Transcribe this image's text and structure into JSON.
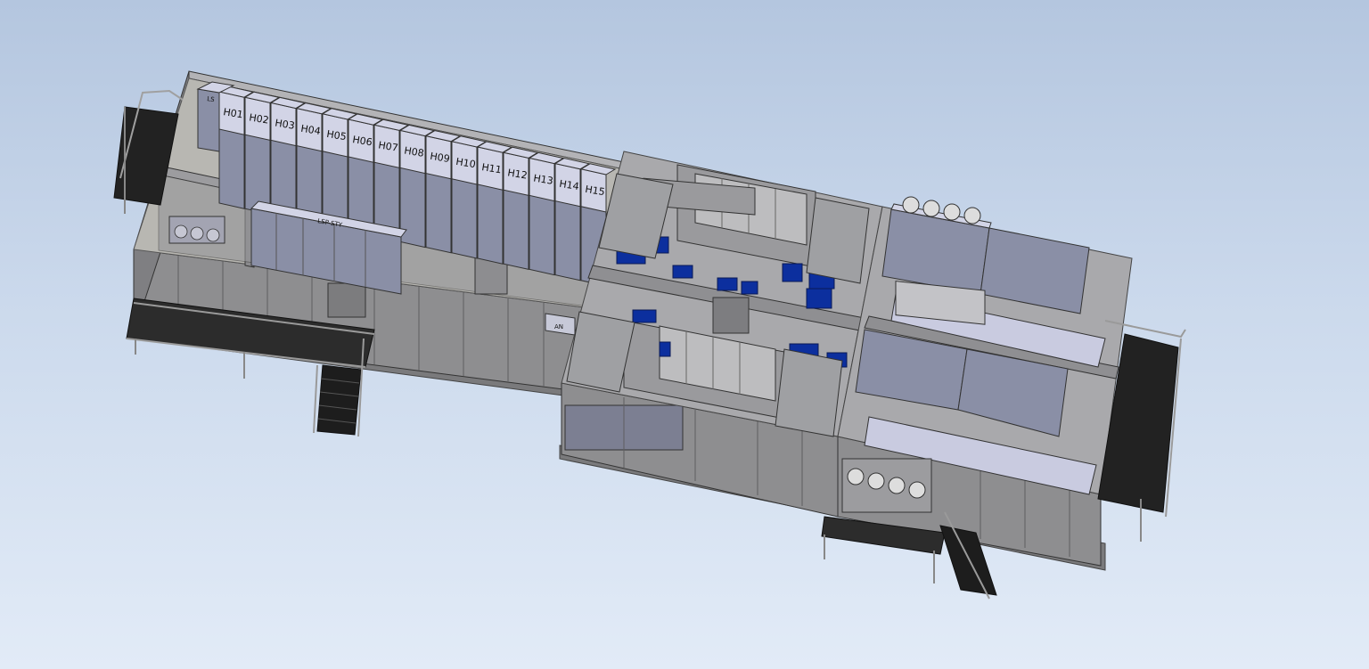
{
  "model": {
    "cabinet_labels": [
      "H01",
      "H02",
      "H03",
      "H04",
      "H05",
      "H06",
      "H07",
      "H08",
      "H09",
      "H10",
      "H11",
      "H12",
      "H13",
      "H14",
      "H15"
    ],
    "small_cabinet_label": "LS",
    "lsp_label": "LSP-STY",
    "corner_label": "AN",
    "colors": {
      "wall": "#8e8e90",
      "wall_dark": "#6f6f72",
      "wall_light": "#b3b3b6",
      "cabinet": "#8a8fa6",
      "cabinet_top": "#d2d4e6",
      "blue_equipment": "#0c2f9e",
      "floor": "#b8b7b2",
      "grating": "#2a2a2a",
      "rail": "#9a9a9a"
    }
  }
}
